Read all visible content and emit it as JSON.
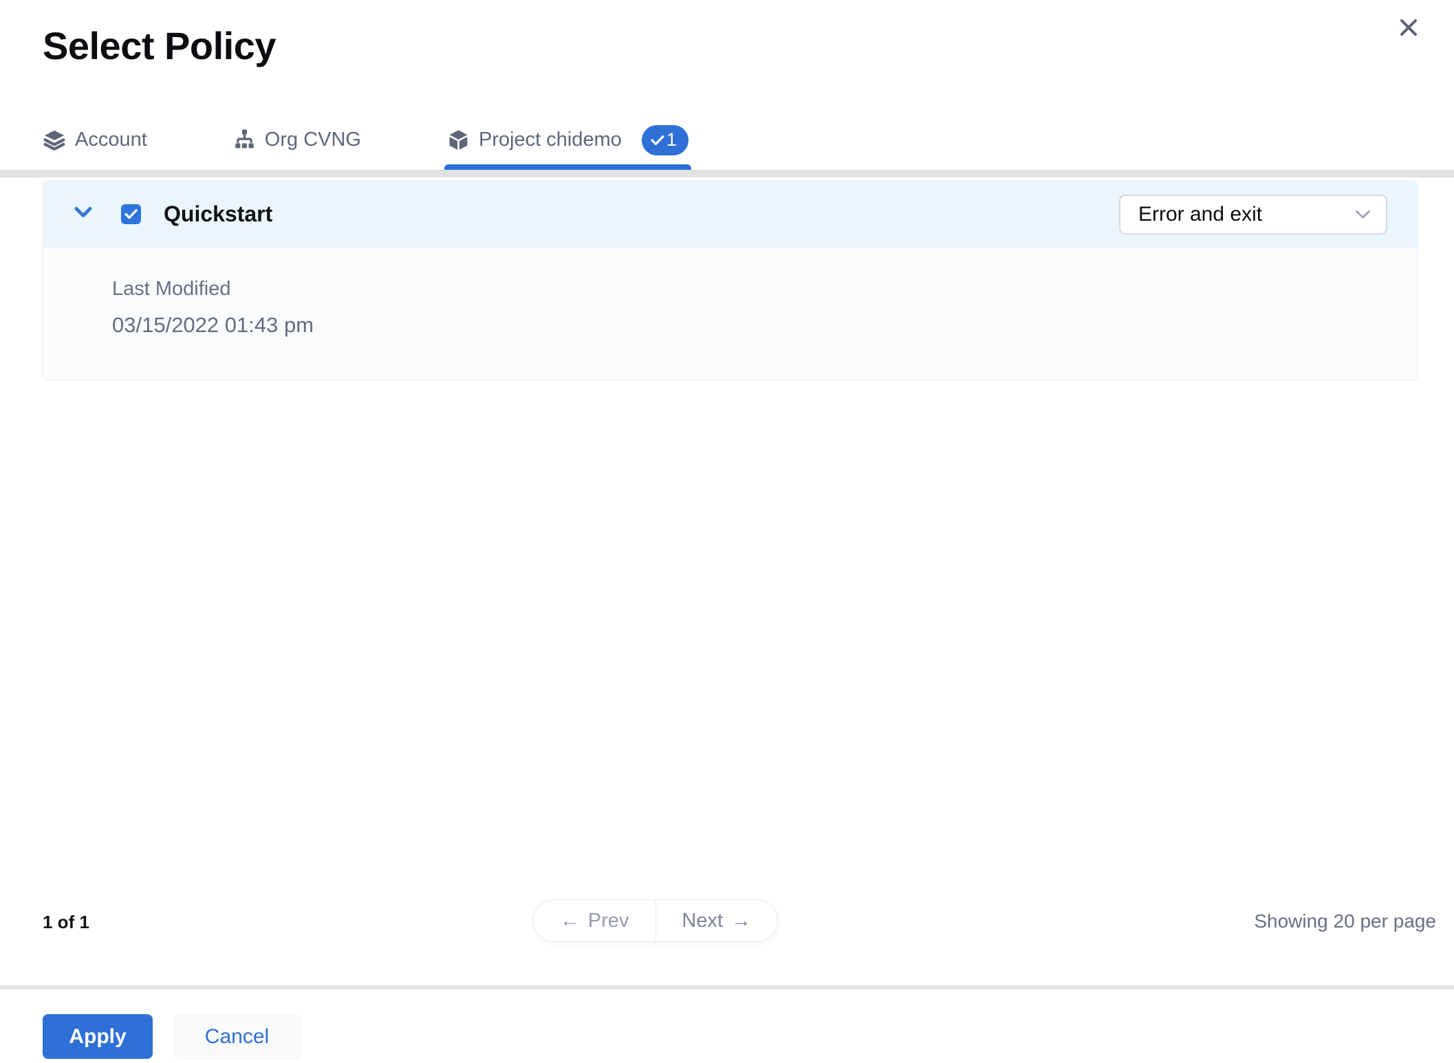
{
  "colors": {
    "accent": "#2e70d5",
    "tab_text": "#5f6679",
    "row_header_bg": "#eaf6fb",
    "expanded_bg": "#fafbfd",
    "divider": "#e2e2e3"
  },
  "header": {
    "title": "Select Policy"
  },
  "tabs": [
    {
      "label": "Account",
      "icon": "layers-icon",
      "active": false
    },
    {
      "label": "Org CVNG",
      "icon": "org-chart-icon",
      "active": false
    },
    {
      "label": "Project chidemo",
      "icon": "cube-icon",
      "badge_count": "1",
      "active": true
    }
  ],
  "policy_list": {
    "row": {
      "name": "Quickstart",
      "checked": true,
      "action_select": {
        "value": "Error and exit"
      },
      "details": {
        "label": "Last Modified",
        "value": "03/15/2022 01:43 pm"
      }
    }
  },
  "pagination": {
    "page_info": "1 of 1",
    "prev_arrow": "←",
    "prev_label": "Prev",
    "next_label": "Next",
    "next_arrow": "→",
    "per_page": "Showing 20 per page"
  },
  "footer": {
    "apply_label": "Apply",
    "cancel_label": "Cancel"
  }
}
